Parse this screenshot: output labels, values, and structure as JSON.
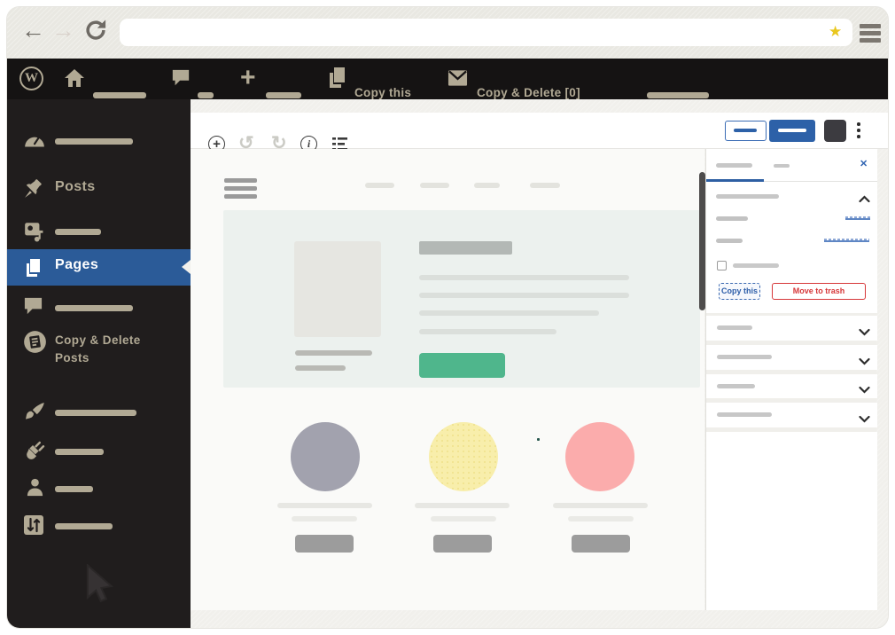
{
  "browser": {
    "address_value": "",
    "back_glyph": "←",
    "forward_glyph": "→",
    "star_glyph": "★"
  },
  "admin_bar": {
    "wp_logo_letter": "W",
    "copy_this_label": "Copy this",
    "copy_delete_label": "Copy & Delete [0]"
  },
  "sidebar": {
    "posts_label": "Posts",
    "pages_label": "Pages",
    "copy_delete_posts_label": "Copy & Delete Posts"
  },
  "editor": {
    "inserter_glyph": "+",
    "undo_glyph": "↺",
    "redo_glyph": "↻",
    "info_glyph": "i"
  },
  "panel": {
    "close_glyph": "✕",
    "copy_this_label": "Copy this",
    "move_to_trash_label": "Move to trash"
  },
  "icons": {
    "browser": [
      "back-arrow-icon",
      "forward-arrow-icon",
      "refresh-icon",
      "bookmark-star-icon",
      "browser-menu-icon"
    ],
    "admin_bar": [
      "wordpress-logo-icon",
      "home-icon",
      "comment-bubble-icon",
      "plus-icon",
      "copy-pages-icon",
      "envelope-icon"
    ],
    "sidebar": [
      "dashboard-gauge-icon",
      "pushpin-icon",
      "media-icon",
      "pages-icon",
      "comments-icon",
      "copy-delete-doc-icon",
      "appearance-brush-icon",
      "plugin-icon",
      "users-icon",
      "settings-sliders-icon"
    ],
    "editor": [
      "inserter-plus-icon",
      "undo-icon",
      "redo-icon",
      "info-icon",
      "list-view-icon",
      "kebab-menu-icon"
    ],
    "panel": [
      "close-icon",
      "chevron-up-icon",
      "chevron-down-icon",
      "checkbox"
    ]
  },
  "colors": {
    "admin_bar_bg": "#151313",
    "sidebar_bg": "#201d1d",
    "wp_beige": "#b1a994",
    "active_menu_blue": "#2b5b98",
    "accent_blue": "#2e5fa3",
    "danger_red": "#d63638",
    "green_button": "#4fb68c",
    "circle_purple": "#a2a2ae",
    "circle_yellow": "#f8eeab",
    "circle_pink": "#fbacac",
    "star_yellow": "#e9c71e",
    "hero_bg": "#ecf1ee",
    "canvas_bg": "#fafaf8"
  }
}
